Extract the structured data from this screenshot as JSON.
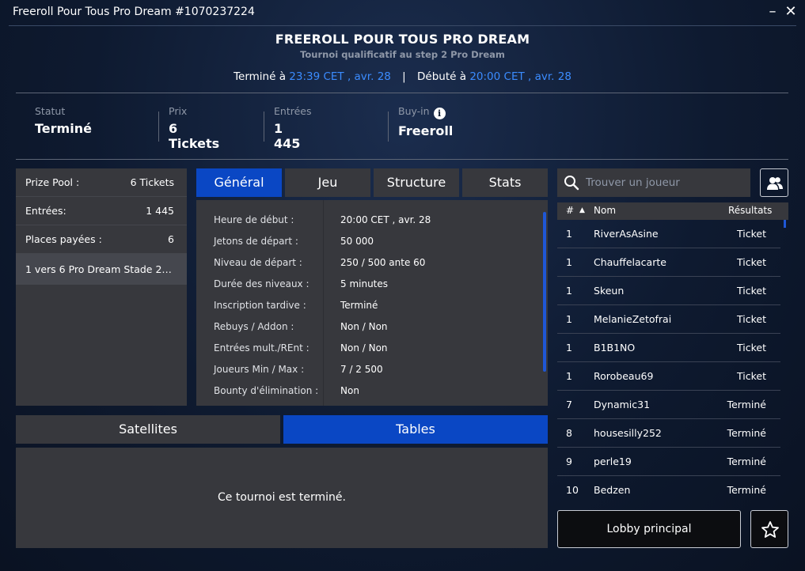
{
  "window": {
    "title": "Freeroll Pour Tous Pro Dream #1070237224",
    "minimize": "–",
    "close": "✕"
  },
  "header": {
    "name": "FREEROLL POUR TOUS PRO DREAM",
    "subtitle": "Tournoi qualificatif au step 2 Pro Dream",
    "ended_label": "Terminé à",
    "ended_time": "23:39 CET , avr. 28",
    "separator": "|",
    "started_label": "Débuté à",
    "started_time": "20:00 CET , avr. 28"
  },
  "stats": [
    {
      "label": "Statut",
      "value": "Terminé"
    },
    {
      "label": "Prix",
      "value": "6 Tickets"
    },
    {
      "label": "Entrées",
      "value": "1 445"
    },
    {
      "label": "Buy-in",
      "value": "Freeroll",
      "info": "i"
    }
  ],
  "prize_pool": {
    "rows": [
      {
        "label": "Prize Pool :",
        "value": "6 Tickets"
      },
      {
        "label": "Entrées:",
        "value": "1 445"
      },
      {
        "label": "Places payées :",
        "value": "6"
      }
    ],
    "payout": "1 vers 6 Pro Dream Stade 2 ..."
  },
  "tabs": [
    {
      "label": "Général",
      "active": true
    },
    {
      "label": "Jeu",
      "active": false
    },
    {
      "label": "Structure",
      "active": false
    },
    {
      "label": "Stats",
      "active": false
    }
  ],
  "general": [
    {
      "label": "Heure de début :",
      "value": "20:00 CET , avr. 28"
    },
    {
      "label": "Jetons de départ :",
      "value": "50 000"
    },
    {
      "label": "Niveau de départ :",
      "value": "250 / 500 ante 60"
    },
    {
      "label": "Durée des niveaux :",
      "value": "5 minutes"
    },
    {
      "label": "Inscription tardive :",
      "value": "Terminé"
    },
    {
      "label": "Rebuys / Addon :",
      "value": "Non / Non"
    },
    {
      "label": "Entrées mult./REnt :",
      "value": "Non / Non"
    },
    {
      "label": "Joueurs Min / Max :",
      "value": "7 / 2 500"
    },
    {
      "label": "Bounty d'élimination :",
      "value": "Non"
    }
  ],
  "bottom_tabs": [
    {
      "label": "Satellites",
      "active": false
    },
    {
      "label": "Tables",
      "active": true
    }
  ],
  "bottom_message": "Ce tournoi est terminé.",
  "search": {
    "placeholder": "Trouver un joueur"
  },
  "players": {
    "headers": {
      "rank": "#",
      "sort": "▲",
      "name": "Nom",
      "result": "Résultats"
    },
    "rows": [
      {
        "rank": "1",
        "name": "RiverAsAsine",
        "result": "Ticket"
      },
      {
        "rank": "1",
        "name": "Chauffelacarte",
        "result": "Ticket"
      },
      {
        "rank": "1",
        "name": "Skeun",
        "result": "Ticket"
      },
      {
        "rank": "1",
        "name": "MelanieZetofrai",
        "result": "Ticket"
      },
      {
        "rank": "1",
        "name": "B1B1NO",
        "result": "Ticket"
      },
      {
        "rank": "1",
        "name": "Rorobeau69",
        "result": "Ticket"
      },
      {
        "rank": "7",
        "name": "Dynamic31",
        "result": "Terminé"
      },
      {
        "rank": "8",
        "name": "housesilly252",
        "result": "Terminé"
      },
      {
        "rank": "9",
        "name": "perle19",
        "result": "Terminé"
      },
      {
        "rank": "10",
        "name": "Bedzen",
        "result": "Terminé"
      }
    ]
  },
  "footer": {
    "lobby_label": "Lobby principal"
  },
  "icons": {
    "search": "search-icon",
    "friends": "users-icon",
    "favorite": "star-icon",
    "info": "info-icon"
  },
  "colors": {
    "accent": "#0a47c4",
    "link": "#3b8cff",
    "panel": "#37383d"
  }
}
